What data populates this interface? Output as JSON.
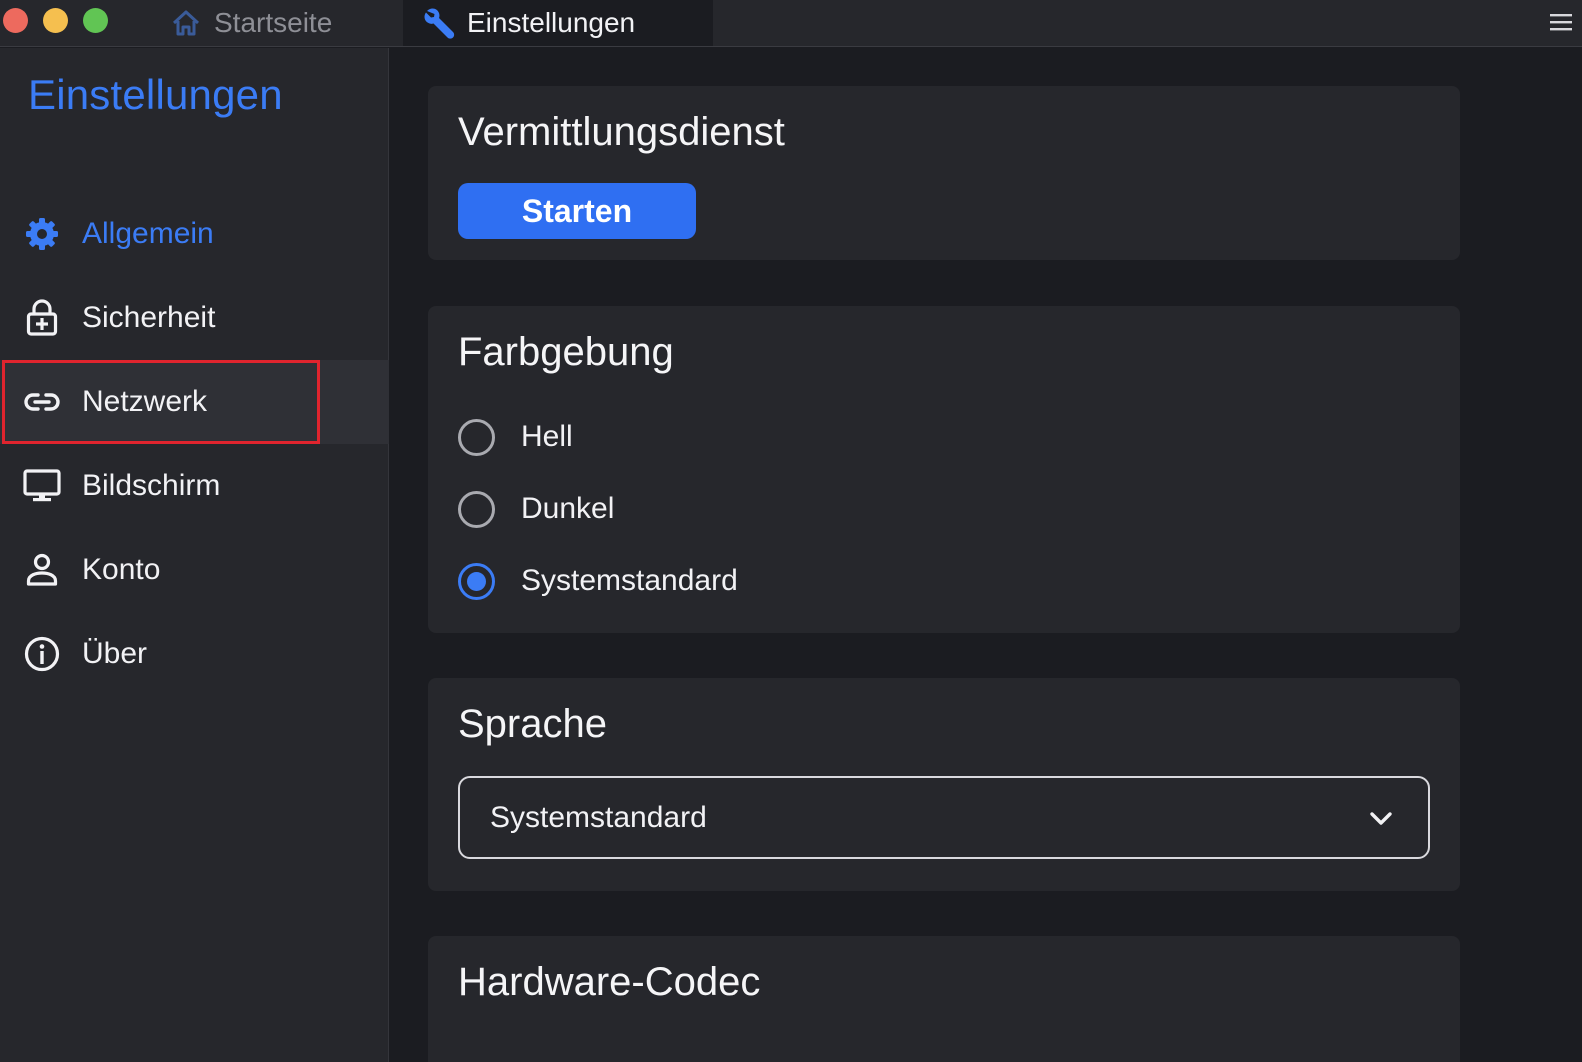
{
  "titlebar": {
    "tabs": [
      {
        "label": "Startseite",
        "icon": "home-icon",
        "active": false
      },
      {
        "label": "Einstellungen",
        "icon": "wrench-icon",
        "active": true
      }
    ],
    "menu_icon": "hamburger-menu-icon"
  },
  "sidebar": {
    "title": "Einstellungen",
    "items": [
      {
        "label": "Allgemein",
        "icon": "gear-icon",
        "active": true
      },
      {
        "label": "Sicherheit",
        "icon": "lock-icon",
        "active": false
      },
      {
        "label": "Netzwerk",
        "icon": "link-icon",
        "active": false,
        "hovered": true,
        "highlighted": true
      },
      {
        "label": "Bildschirm",
        "icon": "monitor-icon",
        "active": false
      },
      {
        "label": "Konto",
        "icon": "user-icon",
        "active": false
      },
      {
        "label": "Über",
        "icon": "info-icon",
        "active": false
      }
    ]
  },
  "main": {
    "service": {
      "title": "Vermittlungsdienst",
      "button_label": "Starten"
    },
    "theme": {
      "title": "Farbgebung",
      "options": [
        {
          "label": "Hell",
          "selected": false
        },
        {
          "label": "Dunkel",
          "selected": false
        },
        {
          "label": "Systemstandard",
          "selected": true
        }
      ]
    },
    "language": {
      "title": "Sprache",
      "selected_value": "Systemstandard"
    },
    "codec": {
      "title": "Hardware-Codec"
    }
  },
  "colors": {
    "accent": "#3b7cf5",
    "button": "#2f6ff2",
    "highlight_border": "#e0242e",
    "background": "#1b1c21",
    "panel": "#26272c"
  }
}
